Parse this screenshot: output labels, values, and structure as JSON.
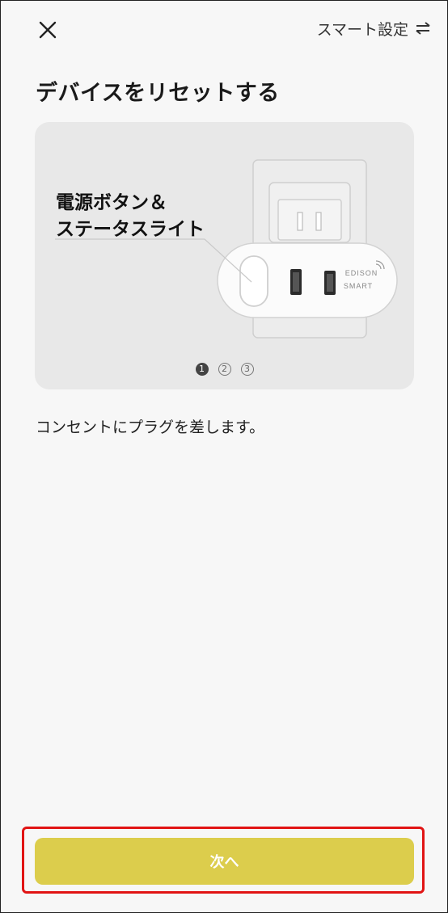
{
  "header": {
    "close_icon": "close-icon",
    "smart_settings_label": "スマート設定",
    "swap_icon": "swap-arrows-icon"
  },
  "page": {
    "title": "デバイスをリセットする"
  },
  "illustration": {
    "label_line1": "電源ボタン＆",
    "label_line2": "ステータスライト",
    "brand_line1": "EDISON",
    "brand_line2": "SMART",
    "pager": {
      "pages": [
        "1",
        "2",
        "3"
      ],
      "current": 1
    }
  },
  "instruction": "コンセントにプラグを差します。",
  "footer": {
    "next_label": "次へ",
    "button_color": "#dccd4c",
    "highlight_color": "#e11414"
  }
}
